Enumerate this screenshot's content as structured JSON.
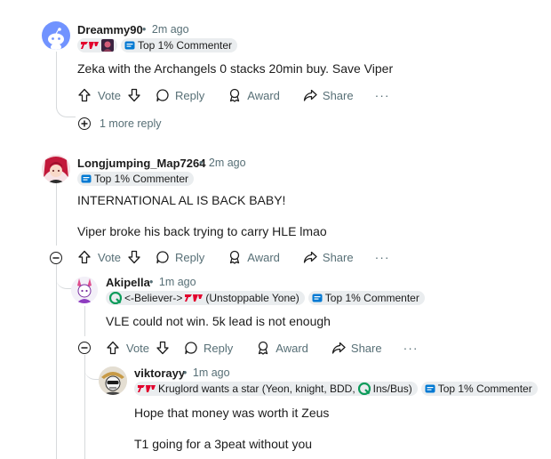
{
  "comments": [
    {
      "username": "Dreammy90",
      "time": "2m ago",
      "flair": "Top 1% Commenter",
      "body": [
        "Zeka with the Archangels 0 stacks 20min buy. Save Viper"
      ],
      "more_replies": "1 more reply"
    },
    {
      "username": "Longjumping_Map7264",
      "time": "2m ago",
      "flair": "Top 1% Commenter",
      "body": [
        "INTERNATIONAL AL IS BACK BABY!",
        "Viper broke his back trying to carry HLE lmao"
      ]
    },
    {
      "username": "Akipella",
      "time": "1m ago",
      "user_flair": "<-Believer->",
      "user_flair_2": "(Unstoppable Yone)",
      "flair": "Top 1% Commenter",
      "body": [
        "VLE could not win. 5k lead is not enough"
      ]
    },
    {
      "username": "viktorayy",
      "time": "1m ago",
      "user_flair": "Kruglord wants a star (Yeon, knight, BDD,",
      "user_flair_2": "Ins/Bus)",
      "flair": "Top 1% Commenter",
      "body": [
        "Hope that money was worth it Zeus",
        "T1 going for a 3peat without you"
      ]
    }
  ],
  "actions": {
    "vote": "Vote",
    "reply": "Reply",
    "award": "Award",
    "share": "Share",
    "more": "···"
  },
  "separator": "•",
  "colors": {
    "accent_red": "#e2012d",
    "meta_gray": "#576f76",
    "flair_bg": "#eaedef",
    "thread_line": "#d7dadc"
  }
}
